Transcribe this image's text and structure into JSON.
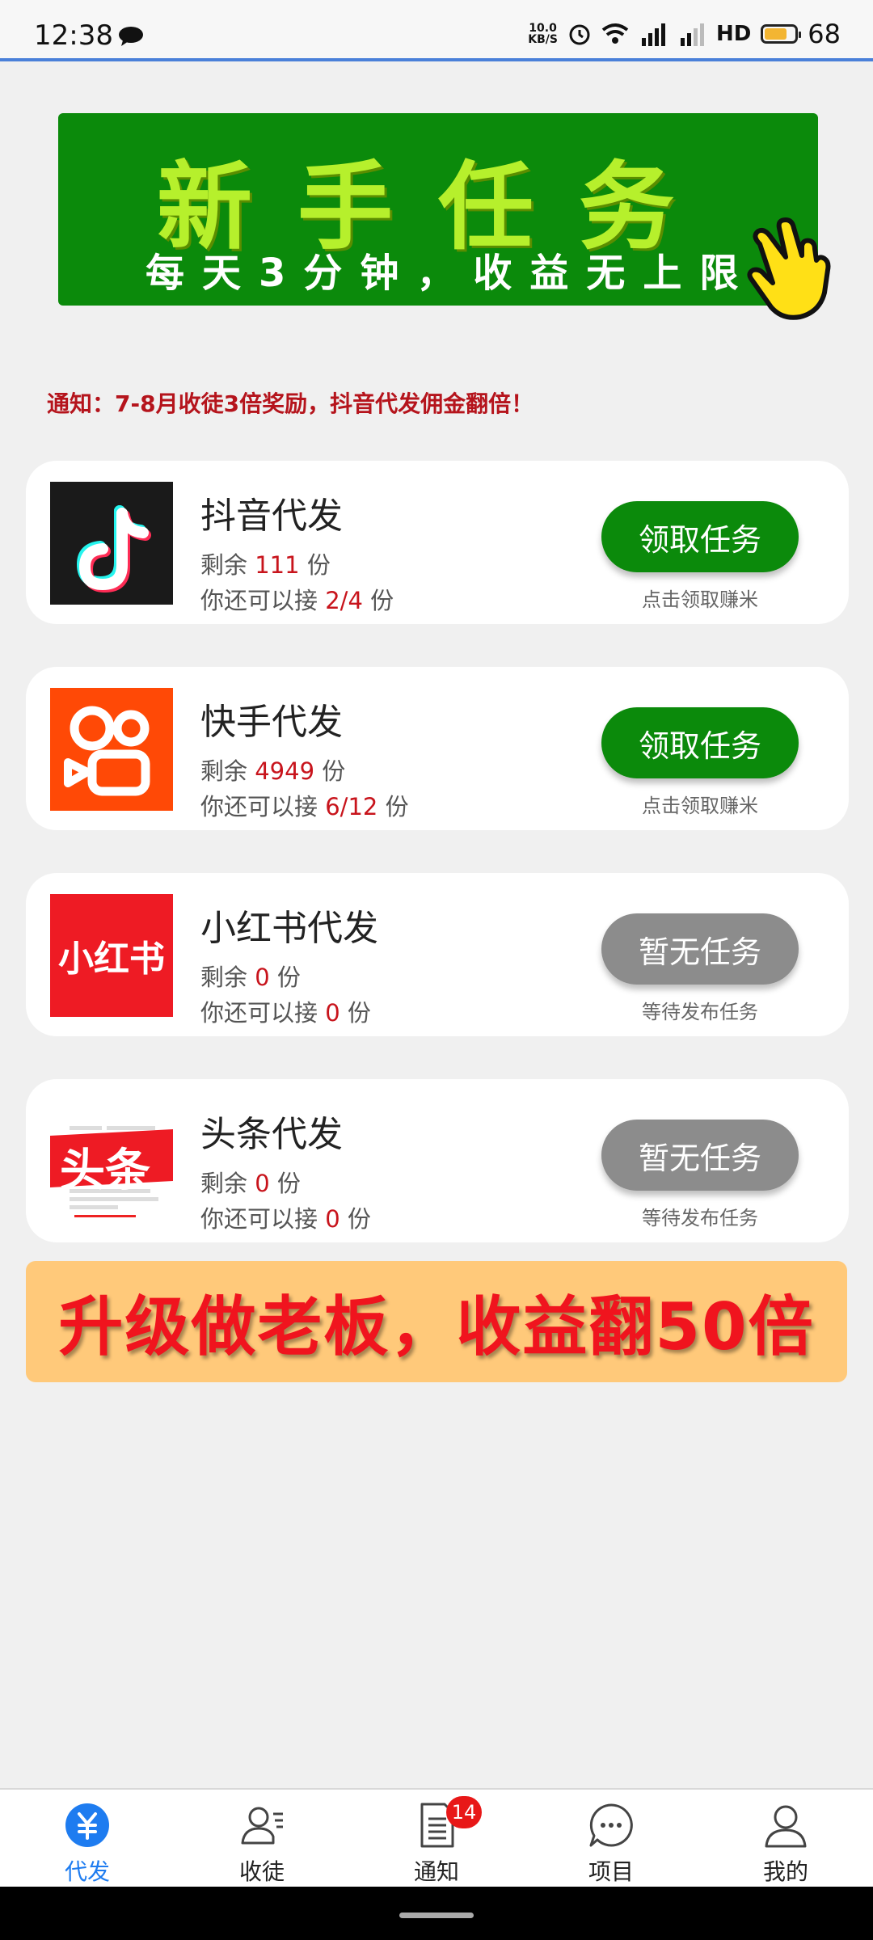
{
  "status_bar": {
    "time": "12:38",
    "net_speed_value": "10.0",
    "net_speed_unit": "KB/S",
    "network": "4G",
    "hd": "HD",
    "battery": "68"
  },
  "banner": {
    "title": "新手任务",
    "subtitle": "每天3分钟，收益无上限",
    "title_color": "#b6f02c",
    "bg_color": "#0b8a0b"
  },
  "notice": "通知：7-8月收徒3倍奖励，抖音代发佣金翻倍！",
  "tasks": [
    {
      "name": "抖音代发",
      "remaining_label": "剩余",
      "remaining": "111",
      "unit": "份",
      "can_take_label": "你还可以接",
      "can_take": "2/4",
      "button": "领取任务",
      "hint": "点击领取赚米",
      "icon": "douyin-logo"
    },
    {
      "name": "快手代发",
      "remaining_label": "剩余",
      "remaining": "4949",
      "unit": "份",
      "can_take_label": "你还可以接",
      "can_take": "6/12",
      "button": "领取任务",
      "hint": "点击领取赚米",
      "icon": "kuaishou-logo"
    },
    {
      "name": "小红书代发",
      "remaining_label": "剩余",
      "remaining": "0",
      "unit": "份",
      "can_take_label": "你还可以接",
      "can_take": "0",
      "button": "暂无任务",
      "hint": "等待发布任务",
      "icon": "xiaohongshu-logo",
      "logo_text": "小红书"
    },
    {
      "name": "头条代发",
      "remaining_label": "剩余",
      "remaining": "0",
      "unit": "份",
      "can_take_label": "你还可以接",
      "can_take": "0",
      "button": "暂无任务",
      "hint": "等待发布任务",
      "icon": "toutiao-logo",
      "logo_text": "头条"
    }
  ],
  "upgrade_banner": "升级做老板，收益翻50倍",
  "bottom_nav": [
    {
      "label": "代发",
      "icon": "yuan-icon",
      "active": true
    },
    {
      "label": "收徒",
      "icon": "contacts-icon"
    },
    {
      "label": "通知",
      "icon": "document-icon",
      "badge": "14"
    },
    {
      "label": "项目",
      "icon": "chat-icon"
    },
    {
      "label": "我的",
      "icon": "person-icon"
    }
  ],
  "colors": {
    "accent_green": "#0b8a0b",
    "disabled_gray": "#8c8c8c",
    "highlight_red": "#c8141c",
    "nav_active": "#1e7cf0"
  }
}
